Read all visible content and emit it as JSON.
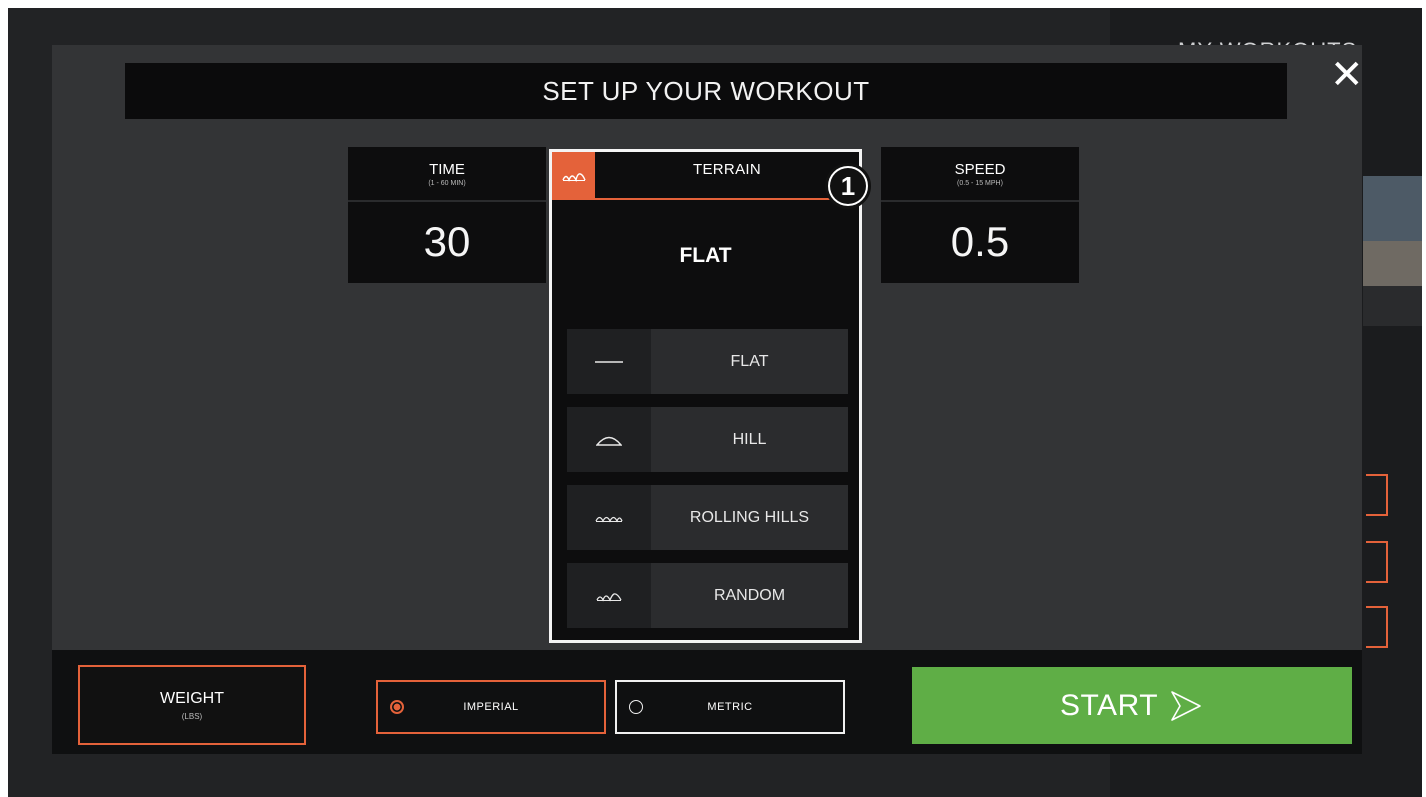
{
  "background": {
    "title": "MY WORKOUTS"
  },
  "modal": {
    "title": "SET UP YOUR WORKOUT",
    "close_icon": "close-icon"
  },
  "time": {
    "label": "TIME",
    "range": "(1 - 60 MIN)",
    "value": "30"
  },
  "terrain": {
    "label": "TERRAIN",
    "selected": "FLAT",
    "options": [
      {
        "label": "FLAT",
        "icon": "flat-terrain-icon"
      },
      {
        "label": "HILL",
        "icon": "hill-terrain-icon"
      },
      {
        "label": "ROLLING HILLS",
        "icon": "rolling-hills-icon"
      },
      {
        "label": "RANDOM",
        "icon": "random-terrain-icon"
      }
    ]
  },
  "callout": {
    "number": "1"
  },
  "speed": {
    "label": "SPEED",
    "range": "(0.5 - 15 MPH)",
    "value": "0.5"
  },
  "weight": {
    "label": "WEIGHT",
    "unit": "(LBS)"
  },
  "units": {
    "imperial": "IMPERIAL",
    "metric": "METRIC",
    "selected": "IMPERIAL"
  },
  "start": {
    "label": "START"
  },
  "colors": {
    "accent": "#e4623a",
    "start": "#5fae46",
    "modal_bg": "#333436",
    "panel_bg": "#0d0d0e"
  }
}
